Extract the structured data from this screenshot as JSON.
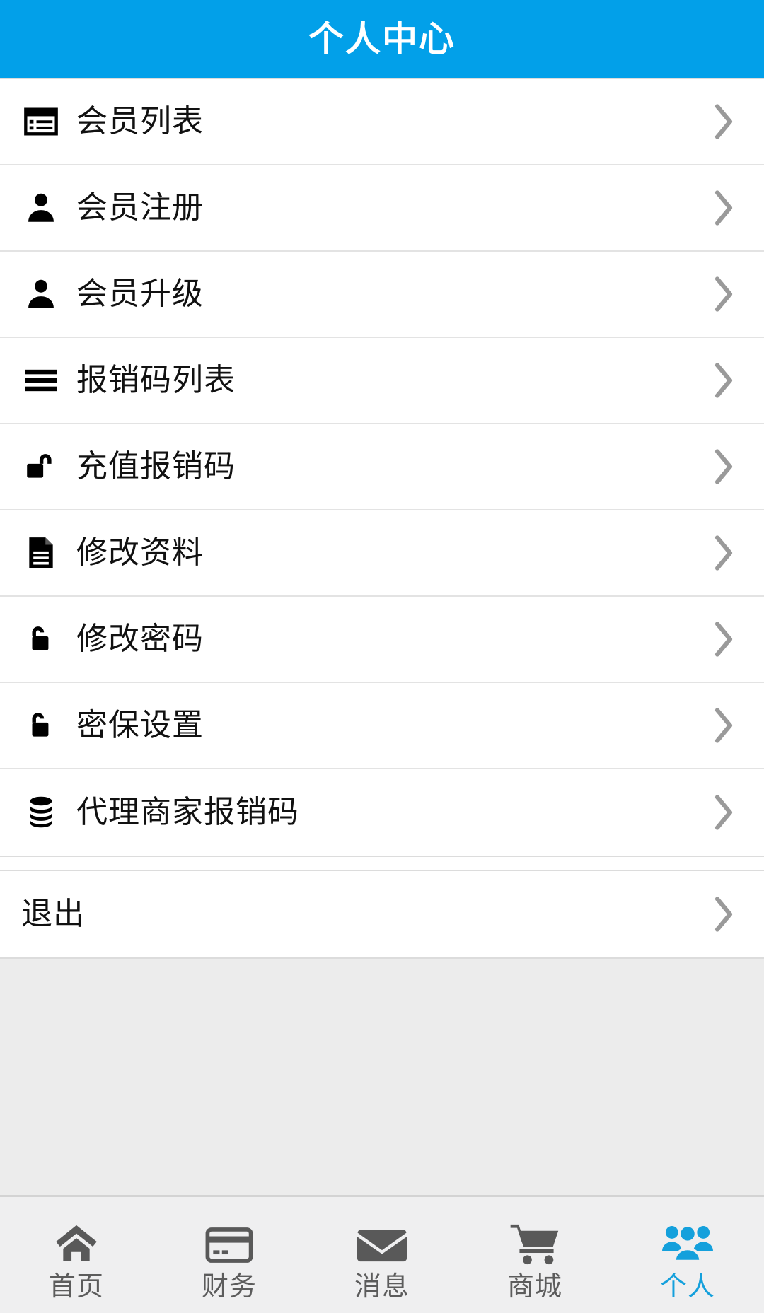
{
  "theme": {
    "header_bg": "#02a0e9",
    "header_text": "#ffffff",
    "accent": "#14a0dc",
    "row_bg": "#ffffff",
    "page_bg": "#ececec",
    "divider": "#e3e3e3",
    "chevron": "#9a9a9a",
    "tab_inactive": "#5c5c5c"
  },
  "header": {
    "title": "个人中心"
  },
  "menu": {
    "items": [
      {
        "label": "会员列表",
        "icon": "list-card-icon"
      },
      {
        "label": "会员注册",
        "icon": "person-icon"
      },
      {
        "label": "会员升级",
        "icon": "person-icon"
      },
      {
        "label": "报销码列表",
        "icon": "hamburger-list-icon"
      },
      {
        "label": "充值报销码",
        "icon": "unlock-right-icon"
      },
      {
        "label": "修改资料",
        "icon": "document-icon"
      },
      {
        "label": "修改密码",
        "icon": "unlock-left-icon"
      },
      {
        "label": "密保设置",
        "icon": "unlock-left-icon"
      },
      {
        "label": "代理商家报销码",
        "icon": "database-icon"
      }
    ],
    "logout": {
      "label": "退出",
      "icon": "none"
    },
    "chevron_icon": "chevron-right-icon"
  },
  "tabbar": {
    "tabs": [
      {
        "label": "首页",
        "icon": "home-icon",
        "active": false
      },
      {
        "label": "财务",
        "icon": "credit-card-icon",
        "active": false
      },
      {
        "label": "消息",
        "icon": "envelope-icon",
        "active": false
      },
      {
        "label": "商城",
        "icon": "cart-icon",
        "active": false
      },
      {
        "label": "个人",
        "icon": "people-group-icon",
        "active": true
      }
    ]
  }
}
